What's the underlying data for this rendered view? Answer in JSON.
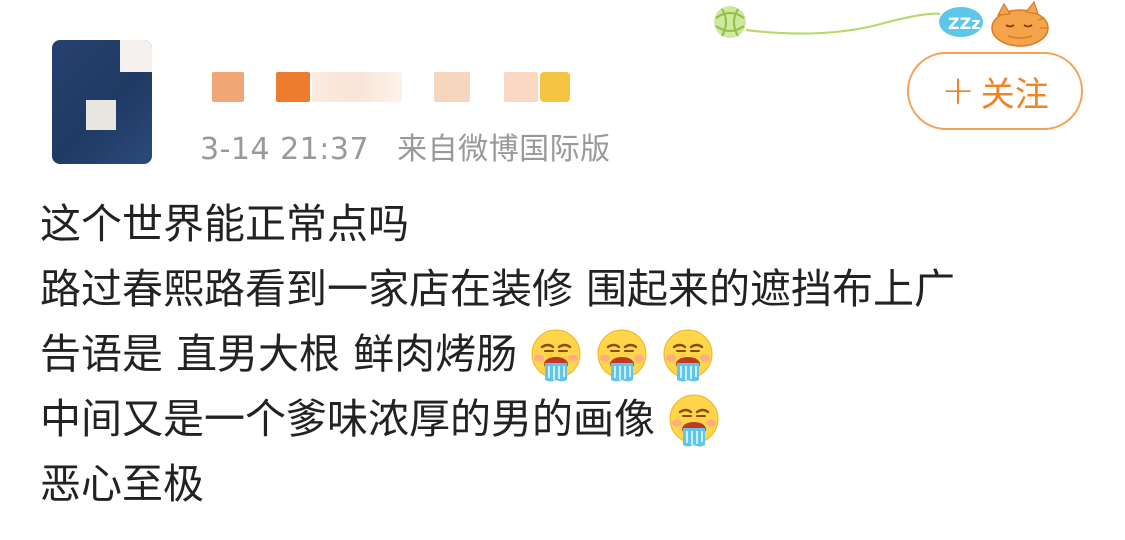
{
  "post": {
    "timestamp": "3-14 21:37",
    "source": "来自微博国际版",
    "follow_label": "关注",
    "follow_plus": "+",
    "lines": [
      "这个世界能正常点吗",
      "路过春熙路看到一家店在装修 围起来的遮挡布上广",
      "告语是 直男大根 鲜肉烤肠",
      "中间又是一个爹味浓厚的男的画像",
      "恶心至极"
    ],
    "emoji_name": "vomit-emoji",
    "decoration_text": "ZZz"
  },
  "colors": {
    "accent": "#f08322",
    "meta_gray": "#999999",
    "text": "#222222"
  }
}
